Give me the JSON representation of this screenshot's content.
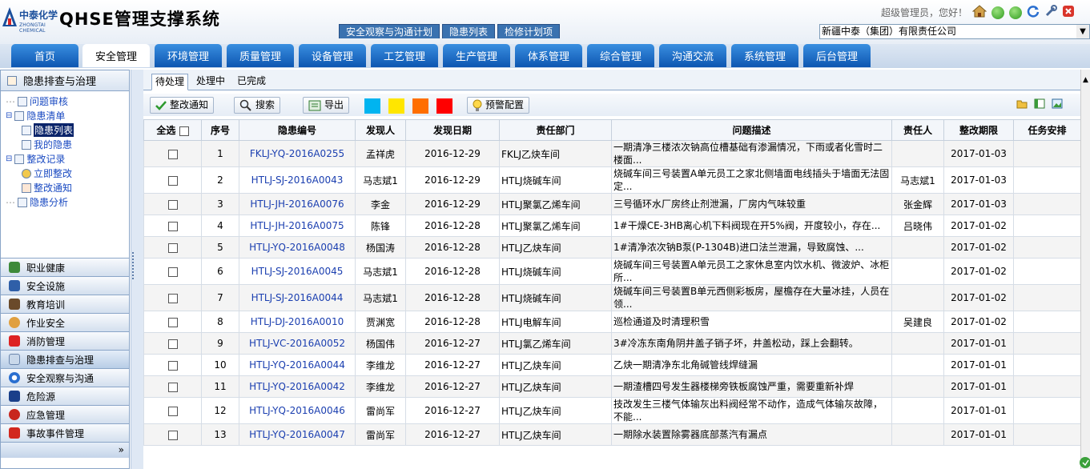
{
  "header": {
    "logo_cn": "中泰化学",
    "logo_en": "ZHONGTAI CHEMICAL",
    "system_title": "QHSE管理支撑系统",
    "top_tabs": [
      "安全观察与沟通计划",
      "隐患列表",
      "检修计划项"
    ],
    "user_greeting": "超级管理员，您好！",
    "company_select": "新疆中泰（集团）有限责任公司"
  },
  "nav": {
    "tabs": [
      "首页",
      "安全管理",
      "环境管理",
      "质量管理",
      "设备管理",
      "工艺管理",
      "生产管理",
      "体系管理",
      "综合管理",
      "沟通交流",
      "系统管理",
      "后台管理"
    ],
    "active": "安全管理"
  },
  "left": {
    "panel_title": "隐患排查与治理",
    "tree": {
      "n1": "问题审核",
      "n2": "隐患清单",
      "n3": "隐患列表",
      "n4": "我的隐患",
      "n5": "整改记录",
      "n6": "立即整改",
      "n7": "整改通知",
      "n8": "隐患分析"
    },
    "accordion": [
      "职业健康",
      "安全设施",
      "教育培训",
      "作业安全",
      "消防管理",
      "隐患排查与治理",
      "安全观察与沟通",
      "危险源",
      "应急管理",
      "事故事件管理"
    ],
    "accordion_active": "隐患排查与治理",
    "footer_expand": "»"
  },
  "subtabs": [
    "待处理",
    "处理中",
    "已完成"
  ],
  "toolbar": {
    "notify": "整改通知",
    "search": "搜索",
    "export": "导出",
    "warn_config": "预警配置",
    "swatches": [
      "#00b4f0",
      "#ffe600",
      "#ff6f00",
      "#ff0000"
    ]
  },
  "table": {
    "headers": [
      "全选",
      "序号",
      "隐患编号",
      "发现人",
      "发现日期",
      "责任部门",
      "问题描述",
      "责任人",
      "整改期限",
      "任务安排"
    ],
    "rows": [
      {
        "no": "1",
        "code": "FKLJ-YQ-2016A0255",
        "finder": "孟祥虎",
        "date": "2016-12-29",
        "dept": "FKLJ乙炔车间",
        "desc": "一期清净三楼浓次钠高位槽基础有渗漏情况，下雨或者化雪时二楼面...",
        "owner": "",
        "deadline": "2017-01-03",
        "task": ""
      },
      {
        "no": "2",
        "code": "HTLJ-SJ-2016A0043",
        "finder": "马志斌1",
        "date": "2016-12-29",
        "dept": "HTLJ烧碱车间",
        "desc": "烧碱车间三号装置A单元员工之家北侧墙面电线插头于墙面无法固定...",
        "owner": "马志斌1",
        "deadline": "2017-01-03",
        "task": ""
      },
      {
        "no": "3",
        "code": "HTLJ-JH-2016A0076",
        "finder": "李金",
        "date": "2016-12-29",
        "dept": "HTLJ聚氯乙烯车间",
        "desc": "三号循环水厂房终止剂泄漏，厂房内气味较重",
        "owner": "张金辉",
        "deadline": "2017-01-03",
        "task": ""
      },
      {
        "no": "4",
        "code": "HTLJ-JH-2016A0075",
        "finder": "陈锋",
        "date": "2016-12-28",
        "dept": "HTLJ聚氯乙烯车间",
        "desc": "1#干燥CE-3HB离心机下料阀现在开5%阀，开度较小，存在...",
        "owner": "吕晓伟",
        "deadline": "2017-01-02",
        "task": ""
      },
      {
        "no": "5",
        "code": "HTLJ-YQ-2016A0048",
        "finder": "杨国涛",
        "date": "2016-12-28",
        "dept": "HTLJ乙炔车间",
        "desc": "1#清净浓次钠B泵(P-1304B)进口法兰泄漏，导致腐蚀、...",
        "owner": "",
        "deadline": "2017-01-02",
        "task": ""
      },
      {
        "no": "6",
        "code": "HTLJ-SJ-2016A0045",
        "finder": "马志斌1",
        "date": "2016-12-28",
        "dept": "HTLJ烧碱车间",
        "desc": "烧碱车间三号装置A单元员工之家休息室内饮水机、微波炉、冰柜所...",
        "owner": "",
        "deadline": "2017-01-02",
        "task": ""
      },
      {
        "no": "7",
        "code": "HTLJ-SJ-2016A0044",
        "finder": "马志斌1",
        "date": "2016-12-28",
        "dept": "HTLJ烧碱车间",
        "desc": "烧碱车间三号装置B单元西侧彩板房，屋檐存在大量冰挂，人员在领...",
        "owner": "",
        "deadline": "2017-01-02",
        "task": ""
      },
      {
        "no": "8",
        "code": "HTLJ-DJ-2016A0010",
        "finder": "贾渊宽",
        "date": "2016-12-28",
        "dept": "HTLJ电解车间",
        "desc": "巡检通道及时清理积雪",
        "owner": "吴建良",
        "deadline": "2017-01-02",
        "task": ""
      },
      {
        "no": "9",
        "code": "HTLJ-VC-2016A0052",
        "finder": "杨国伟",
        "date": "2016-12-27",
        "dept": "HTLJ氯乙烯车间",
        "desc": "3#冷冻东南角阴井盖子销子坏，井盖松动，踩上会翻转。",
        "owner": "",
        "deadline": "2017-01-01",
        "task": ""
      },
      {
        "no": "10",
        "code": "HTLJ-YQ-2016A0044",
        "finder": "李维龙",
        "date": "2016-12-27",
        "dept": "HTLJ乙炔车间",
        "desc": "乙炔一期清净东北角碱管线焊缝漏",
        "owner": "",
        "deadline": "2017-01-01",
        "task": ""
      },
      {
        "no": "11",
        "code": "HTLJ-YQ-2016A0042",
        "finder": "李维龙",
        "date": "2016-12-27",
        "dept": "HTLJ乙炔车间",
        "desc": "一期渣槽四号发生器楼梯旁铁板腐蚀严重，需要重新补焊",
        "owner": "",
        "deadline": "2017-01-01",
        "task": ""
      },
      {
        "no": "12",
        "code": "HTLJ-YQ-2016A0046",
        "finder": "雷尚军",
        "date": "2016-12-27",
        "dept": "HTLJ乙炔车间",
        "desc": "技改发生三楼气体输灰出料阀经常不动作，造成气体输灰故障，不能...",
        "owner": "",
        "deadline": "2017-01-01",
        "task": ""
      },
      {
        "no": "13",
        "code": "HTLJ-YQ-2016A0047",
        "finder": "雷尚军",
        "date": "2016-12-27",
        "dept": "HTLJ乙炔车间",
        "desc": "一期除水装置除雾器底部蒸汽有漏点",
        "owner": "",
        "deadline": "2017-01-01",
        "task": ""
      }
    ]
  }
}
